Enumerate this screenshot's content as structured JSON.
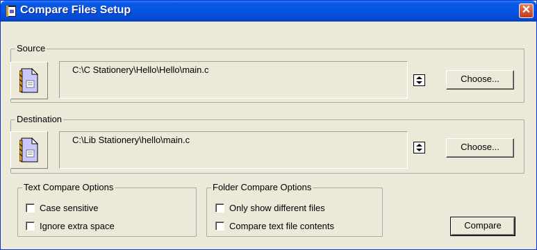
{
  "window": {
    "title": "Compare Files Setup",
    "close_glyph": "✕"
  },
  "source": {
    "legend": "Source",
    "path": "C:\\C Stationery\\Hello\\Hello\\main.c",
    "choose_label": "Choose...",
    "icon": "document-icon"
  },
  "destination": {
    "legend": "Destination",
    "path": "C:\\Lib Stationery\\hello\\main.c",
    "choose_label": "Choose...",
    "icon": "document-icon"
  },
  "text_options": {
    "legend": "Text Compare Options",
    "items": [
      {
        "label": "Case sensitive",
        "checked": false
      },
      {
        "label": "Ignore extra space",
        "checked": false
      }
    ]
  },
  "folder_options": {
    "legend": "Folder Compare Options",
    "items": [
      {
        "label": "Only show different files",
        "checked": false
      },
      {
        "label": "Compare text file contents",
        "checked": false
      }
    ]
  },
  "compare_label": "Compare",
  "colors": {
    "titlebar": "#0554e3",
    "face": "#ece9d8",
    "close": "#c4371c"
  }
}
